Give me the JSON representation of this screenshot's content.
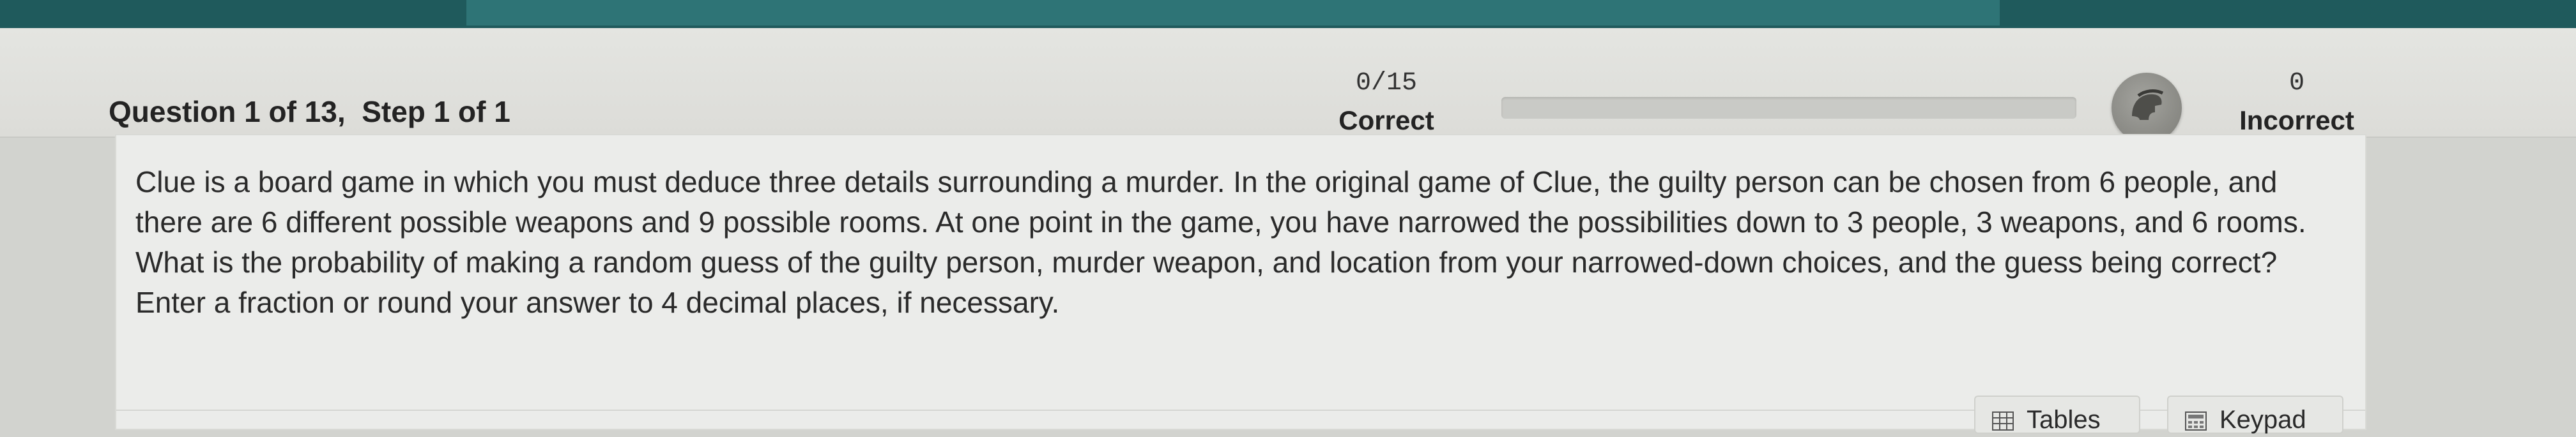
{
  "header": {
    "question_label": "Question 1 of 13,",
    "step_label": "Step 1 of 1",
    "correct_count": "0/15",
    "correct_label": "Correct",
    "incorrect_count": "0",
    "incorrect_label": "Incorrect",
    "progress_fraction": 0
  },
  "question": {
    "line1": "Clue is a board game in which you must deduce three details surrounding a murder. In the original game of Clue, the guilty person can be chosen from 6 people, and",
    "line2": "there are 6 different possible weapons and 9 possible rooms. At one point in the game, you have narrowed the possibilities down to 3 people, 3 weapons, and 6 rooms.",
    "line3": "What is the probability of making a random guess of the guilty person, murder weapon, and location from your narrowed-down choices, and the guess being correct?",
    "line4": "Enter a fraction or round your answer to 4 decimal places, if necessary."
  },
  "tools": {
    "tables_label": "Tables",
    "keypad_label": "Keypad"
  },
  "icons": {
    "badge": "spartan-helmet-icon",
    "tables": "table-grid-icon",
    "keypad": "calculator-icon"
  }
}
